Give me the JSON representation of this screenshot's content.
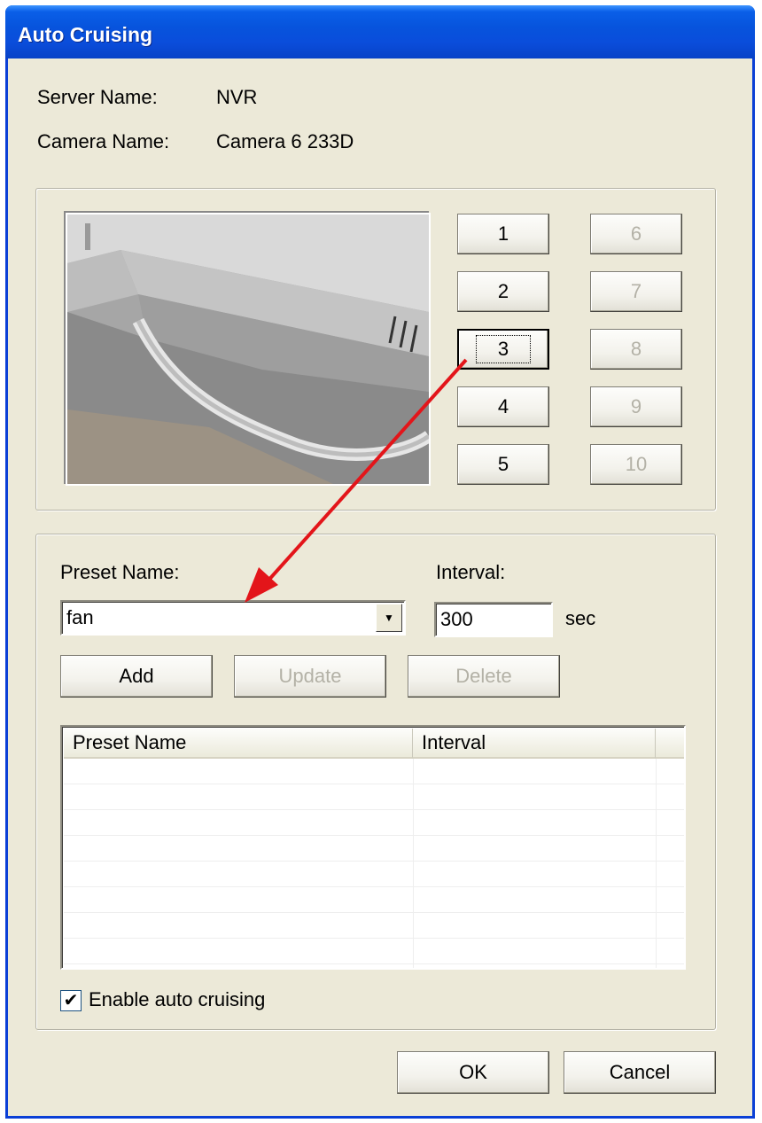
{
  "window": {
    "title": "Auto Cruising"
  },
  "info": {
    "server_label": "Server Name:",
    "server_value": "NVR",
    "camera_label": "Camera Name:",
    "camera_value": "Camera 6 233D"
  },
  "presets": {
    "buttons": [
      {
        "label": "1",
        "enabled": true
      },
      {
        "label": "2",
        "enabled": true
      },
      {
        "label": "3",
        "enabled": true,
        "focused": true
      },
      {
        "label": "4",
        "enabled": true
      },
      {
        "label": "5",
        "enabled": true
      },
      {
        "label": "6",
        "enabled": false
      },
      {
        "label": "7",
        "enabled": false
      },
      {
        "label": "8",
        "enabled": false
      },
      {
        "label": "9",
        "enabled": false
      },
      {
        "label": "10",
        "enabled": false
      }
    ]
  },
  "form": {
    "preset_name_label": "Preset Name:",
    "preset_name_value": "fan",
    "interval_label": "Interval:",
    "interval_value": "300",
    "interval_unit": "sec",
    "add_label": "Add",
    "update_label": "Update",
    "delete_label": "Delete"
  },
  "table": {
    "columns": [
      "Preset Name",
      "Interval"
    ],
    "rows": []
  },
  "options": {
    "enable_auto_cruising_label": "Enable auto cruising",
    "enable_auto_cruising_checked": true
  },
  "footer": {
    "ok_label": "OK",
    "cancel_label": "Cancel"
  },
  "colors": {
    "titlebar": "#0a4ddb",
    "dialog_bg": "#ece9d8",
    "annotation_arrow": "#e3151a"
  }
}
